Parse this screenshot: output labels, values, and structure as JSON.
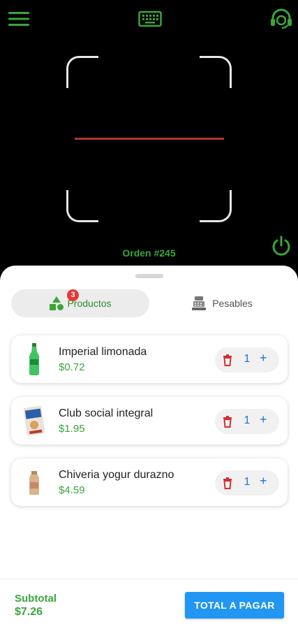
{
  "header": {
    "menu_icon": "hamburger-menu-icon",
    "keyboard_icon": "keyboard-icon",
    "support_icon": "support-agent-icon",
    "accent": "#3aa53a"
  },
  "scanner": {
    "order_label": "Orden #245",
    "line_color": "#b0362e"
  },
  "tabs": [
    {
      "label": "Productos",
      "icon": "shapes-icon",
      "badge": "3",
      "active": true
    },
    {
      "label": "Pesables",
      "icon": "scale-register-icon",
      "active": false
    }
  ],
  "items": [
    {
      "name": "Imperial limonada",
      "price": "$0.72",
      "qty": "1",
      "image": "green-bottle"
    },
    {
      "name": "Club social integral",
      "price": "$1.95",
      "qty": "1",
      "image": "cracker-pack"
    },
    {
      "name": "Chiveria yogur durazno",
      "price": "$4.59",
      "qty": "1",
      "image": "yogurt-bottle"
    }
  ],
  "footer": {
    "subtotal_label": "Subtotal",
    "subtotal_value": "$7.26",
    "pay_label": "TOTAL A PAGAR",
    "pay_color": "#2196f3"
  }
}
